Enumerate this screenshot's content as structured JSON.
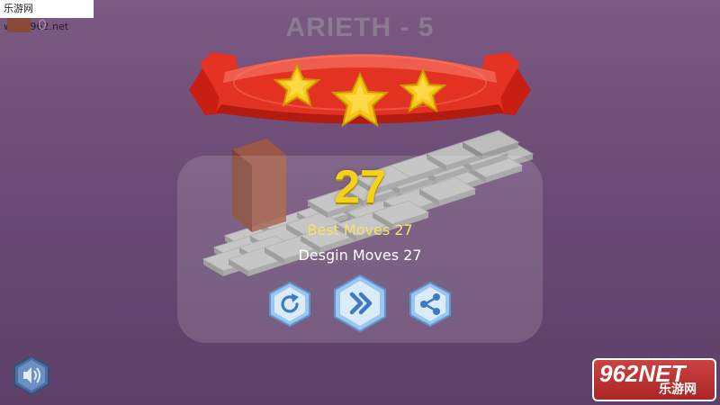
{
  "watermark": {
    "text": "乐游网 www.962.net"
  },
  "moves_counter": {
    "value": "0"
  },
  "level": {
    "title": "ARIETH - 5",
    "stars_earned": 3,
    "stars_total": 3
  },
  "result": {
    "score": "27",
    "best_moves": "Best Moves 27",
    "design_moves": "Desgin Moves 27"
  },
  "buttons": [
    {
      "name": "restart-button",
      "icon": "restart-icon"
    },
    {
      "name": "next-level-button",
      "icon": "fast-forward-icon"
    },
    {
      "name": "share-button",
      "icon": "share-icon"
    }
  ],
  "sound_button": {
    "icon": "speaker-icon"
  },
  "brand_logo": {
    "text": "962NET",
    "subtext": "乐游网"
  },
  "colors": {
    "background": "#6a4a74",
    "ribbon": "#e02a1a",
    "star": "#f6c21a",
    "score": "#f4d21a",
    "best_moves": "#f6e16a",
    "hex_button": "#cfe3f7",
    "tile": "#bdbdbd",
    "block": "#8a4a3a"
  }
}
